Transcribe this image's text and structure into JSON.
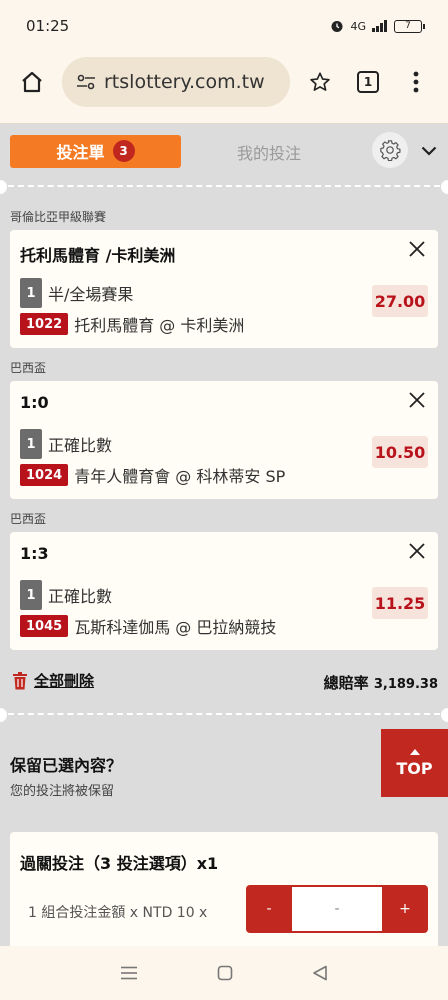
{
  "status_bar": {
    "time": "01:25",
    "network": "4G",
    "battery": "7"
  },
  "browser": {
    "url": "rtslottery.com.tw",
    "tab_count": "1"
  },
  "betslip": {
    "tab_active": "投注單",
    "tab_active_badge": "3",
    "tab_inactive": "我的投注"
  },
  "bets": [
    {
      "league": "哥倫比亞甲級聯賽",
      "title": "托利馬體育 /卡利美洲",
      "sel_num": "1",
      "market": "半/全場賽果",
      "code": "1022",
      "match": "托利馬體育 @ 卡利美洲",
      "odds": "27.00"
    },
    {
      "league": "巴西盃",
      "title": "1:0",
      "sel_num": "1",
      "market": "正確比數",
      "code": "1024",
      "match": "青年人體育會 @ 科林蒂安 SP",
      "odds": "10.50"
    },
    {
      "league": "巴西盃",
      "title": "1:3",
      "sel_num": "1",
      "market": "正確比數",
      "code": "1045",
      "match": "瓦斯科達伽馬 @ 巴拉納競技",
      "odds": "11.25"
    }
  ],
  "footer": {
    "delete_all": "全部刪除",
    "total_odds_label": "總賠率",
    "total_odds_value": "3,189.38"
  },
  "keep": {
    "title": "保留已選內容？",
    "subtitle": "您的投注將被保留",
    "top_label": "TOP"
  },
  "parlay": {
    "title": "過關投注（3 投注選項）x1",
    "stake_label": "1 組合投注金額 x NTD 10 x",
    "minus": "-",
    "amount": "-",
    "plus": "+"
  }
}
